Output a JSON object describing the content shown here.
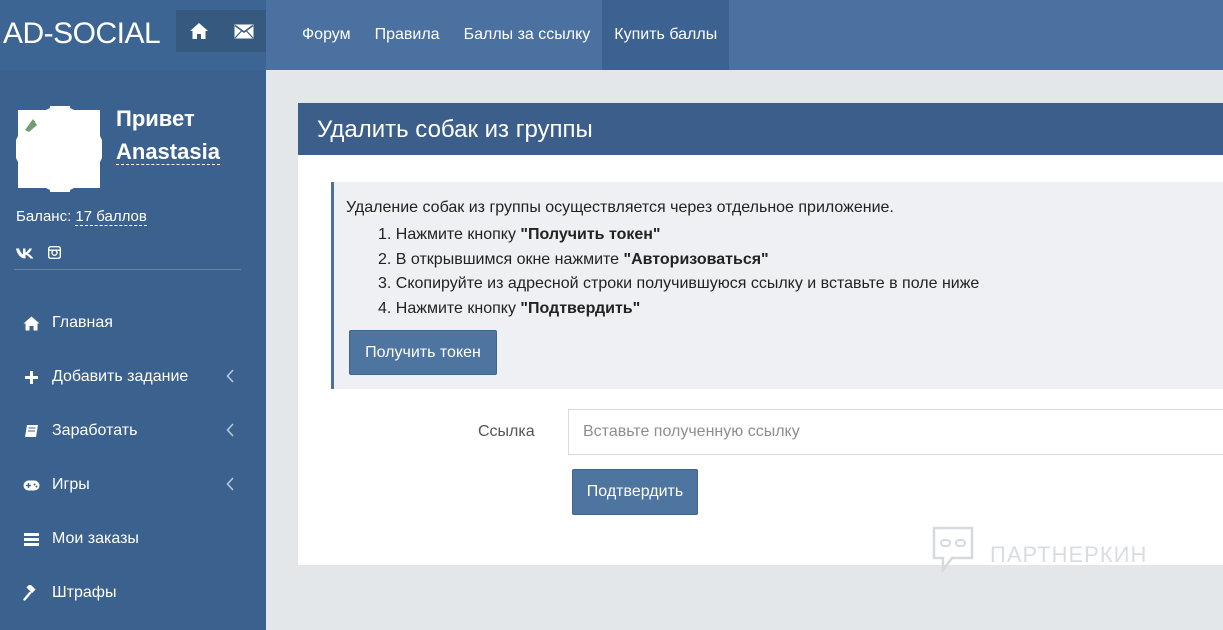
{
  "header": {
    "brand": "AD-SOCIAL",
    "quick_icons": [
      "home-icon",
      "envelope-icon"
    ],
    "nav": [
      {
        "label": "Форум"
      },
      {
        "label": "Правила"
      },
      {
        "label": "Баллы за ссылку"
      },
      {
        "label": "Купить баллы"
      }
    ]
  },
  "sidebar": {
    "greeting_line1": "Привет",
    "greeting_name": "Anastasia",
    "balance_label": "Баланс:",
    "balance_value": "17 баллов",
    "social_icons": [
      "vk-icon",
      "instagram-icon"
    ],
    "menu": [
      {
        "label": "Главная",
        "icon": "home-icon"
      },
      {
        "label": "Добавить задание",
        "icon": "plus-icon"
      },
      {
        "label": "Заработать",
        "icon": "book-icon"
      },
      {
        "label": "Игры",
        "icon": "gamepad-icon"
      },
      {
        "label": "Мои заказы",
        "icon": "list-icon"
      },
      {
        "label": "Штрафы",
        "icon": "gavel-icon"
      }
    ]
  },
  "main": {
    "title": "Удалить собак из группы",
    "intro": "Удаление собак из группы осуществляется через отдельное приложение.",
    "steps": [
      {
        "text": "Нажмите кнопку ",
        "bold": "\"Получить токен\""
      },
      {
        "text": "В открывшимся окне нажмите ",
        "bold": "\"Авторизоваться\""
      },
      {
        "text": "Скопируйте из адресной строки получившуюся ссылку и вставьте в поле ниже",
        "bold": ""
      },
      {
        "text": "Нажмите кнопку ",
        "bold": "\"Подтвердить\""
      }
    ],
    "token_button": "Получить токен",
    "link_label": "Ссылка",
    "link_placeholder": "Вставьте полученную ссылку",
    "link_value": "",
    "confirm_button": "Подтвердить"
  },
  "watermark": "ПАРТНЕРКИН",
  "colors": {
    "topbar": "#4b71a0",
    "brand_bg": "#3c6594",
    "sidebar": "#3b628e",
    "panel_header": "#3c5e8b",
    "button": "#4e74a0",
    "background": "#e4e7ea"
  }
}
